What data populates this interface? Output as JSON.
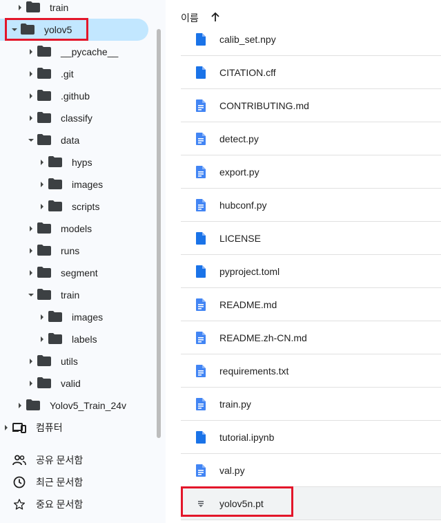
{
  "tree": {
    "items": [
      {
        "label": "train",
        "expanded": false,
        "depth": 1
      },
      {
        "label": "yolov5",
        "expanded": true,
        "depth": 0,
        "selected": true
      },
      {
        "label": "__pycache__",
        "expanded": false,
        "depth": 2
      },
      {
        "label": ".git",
        "expanded": false,
        "depth": 2
      },
      {
        "label": ".github",
        "expanded": false,
        "depth": 2
      },
      {
        "label": "classify",
        "expanded": false,
        "depth": 2
      },
      {
        "label": "data",
        "expanded": true,
        "depth": 2
      },
      {
        "label": "hyps",
        "expanded": false,
        "depth": 3
      },
      {
        "label": "images",
        "expanded": false,
        "depth": 3
      },
      {
        "label": "scripts",
        "expanded": false,
        "depth": 3
      },
      {
        "label": "models",
        "expanded": false,
        "depth": 2
      },
      {
        "label": "runs",
        "expanded": false,
        "depth": 2
      },
      {
        "label": "segment",
        "expanded": false,
        "depth": 2
      },
      {
        "label": "train",
        "expanded": true,
        "depth": 2
      },
      {
        "label": "images",
        "expanded": false,
        "depth": 3
      },
      {
        "label": "labels",
        "expanded": false,
        "depth": 3
      },
      {
        "label": "utils",
        "expanded": false,
        "depth": 2
      },
      {
        "label": "valid",
        "expanded": false,
        "depth": 2
      },
      {
        "label": "Yolov5_Train_24v",
        "expanded": false,
        "depth": 1
      }
    ],
    "computer_label": "컴퓨터",
    "shared_label": "공유 문서함",
    "recent_label": "최근 문서함",
    "starred_label": "중요 문서함"
  },
  "list": {
    "header_name": "이름",
    "sort_icon": "arrow-up-icon",
    "files": [
      {
        "name": "calib_set.npy",
        "icon": "file-icon"
      },
      {
        "name": "CITATION.cff",
        "icon": "file-icon"
      },
      {
        "name": "CONTRIBUTING.md",
        "icon": "doc-icon"
      },
      {
        "name": "detect.py",
        "icon": "doc-icon"
      },
      {
        "name": "export.py",
        "icon": "doc-icon"
      },
      {
        "name": "hubconf.py",
        "icon": "doc-icon"
      },
      {
        "name": "LICENSE",
        "icon": "file-icon"
      },
      {
        "name": "pyproject.toml",
        "icon": "file-icon"
      },
      {
        "name": "README.md",
        "icon": "doc-icon"
      },
      {
        "name": "README.zh-CN.md",
        "icon": "doc-icon"
      },
      {
        "name": "requirements.txt",
        "icon": "doc-icon"
      },
      {
        "name": "train.py",
        "icon": "doc-icon"
      },
      {
        "name": "tutorial.ipynb",
        "icon": "file-icon"
      },
      {
        "name": "val.py",
        "icon": "doc-icon"
      },
      {
        "name": "yolov5n.pt",
        "icon": "binary-file-icon"
      }
    ]
  },
  "colors": {
    "selection": "#c2e7ff",
    "highlight_box": "#e3162a",
    "file_blue": "#1a73e8"
  }
}
